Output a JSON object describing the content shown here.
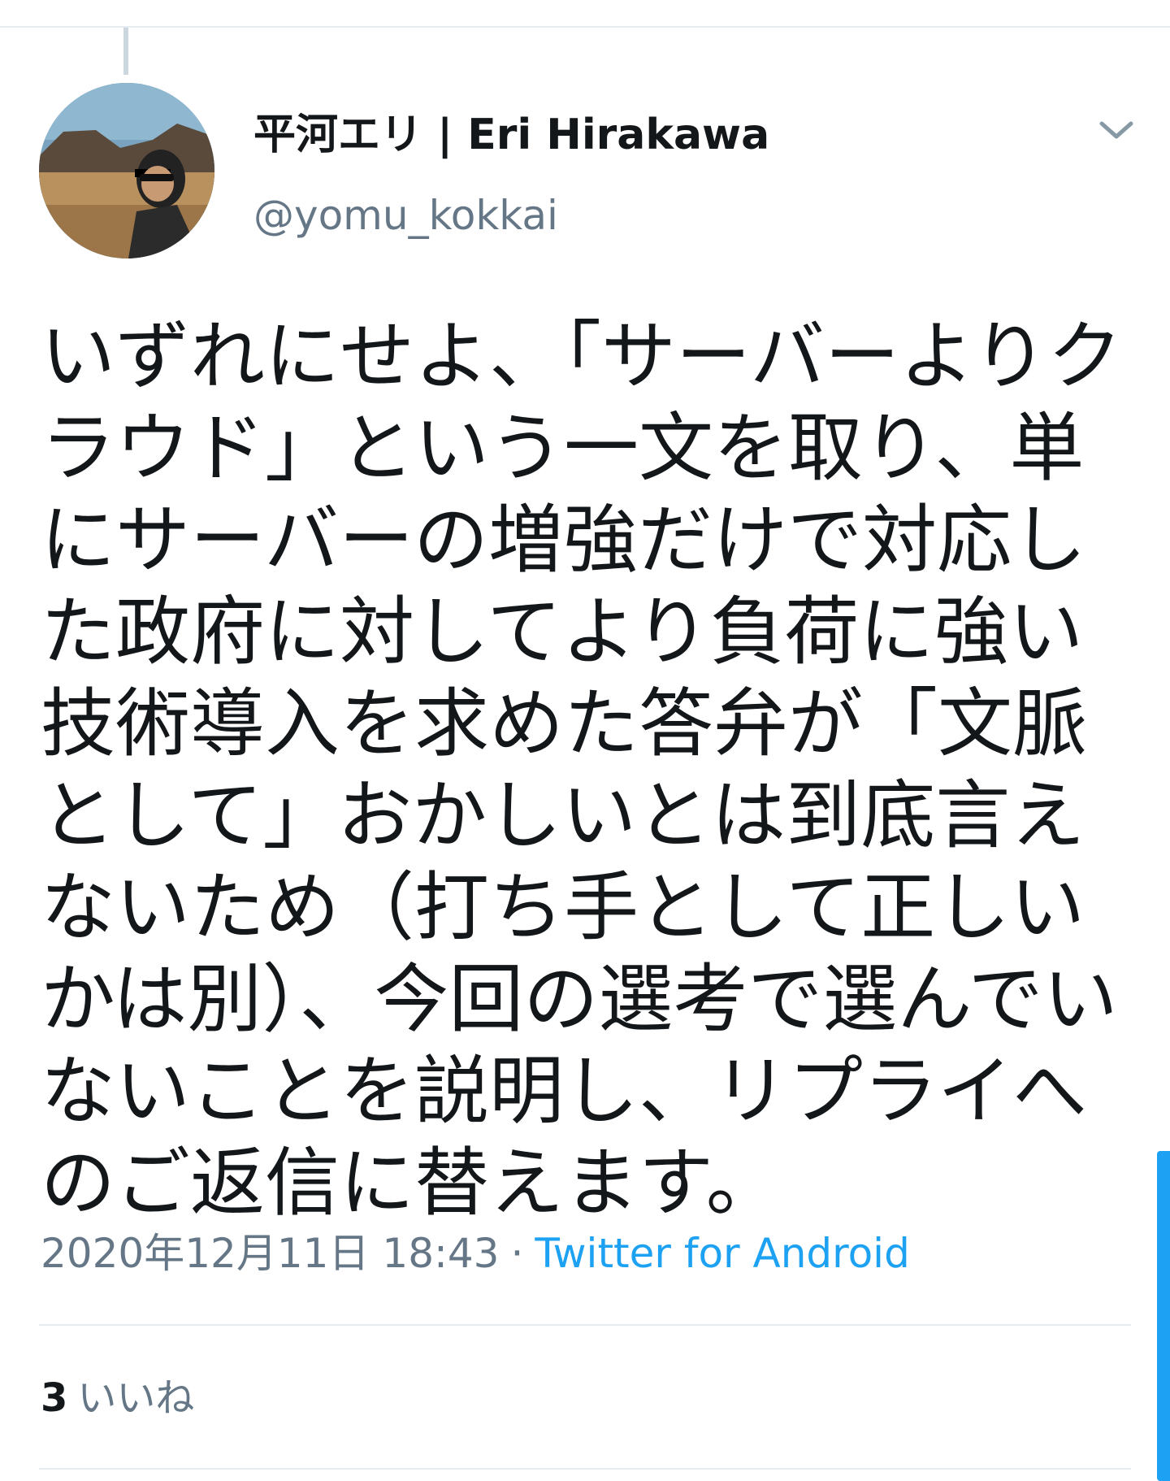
{
  "tweet": {
    "author": {
      "display_name": "平河エリ | Eri Hirakawa",
      "handle": "@yomu_kokkai"
    },
    "text": "いずれにせよ、「サーバーよりクラウド」という一文を取り、単にサーバーの増強だけで対応した政府に対してより負荷に強い技術導入を求めた答弁が「文脈として」おかしいとは到底言えないため（打ち手として正しいかは別）、今回の選考で選んでいないことを説明し、リプライへのご返信に替えます。",
    "timestamp": "2020年12月11日 18:43",
    "separator": "·",
    "source": "Twitter for Android",
    "likes": {
      "count": "3",
      "label": "いいね"
    }
  },
  "icons": {
    "menu": "chevron-down-icon",
    "avatar": "profile-avatar"
  },
  "colors": {
    "text": "#14171a",
    "secondary": "#657786",
    "link": "#1da1f2",
    "divider": "#e6ecf0"
  }
}
